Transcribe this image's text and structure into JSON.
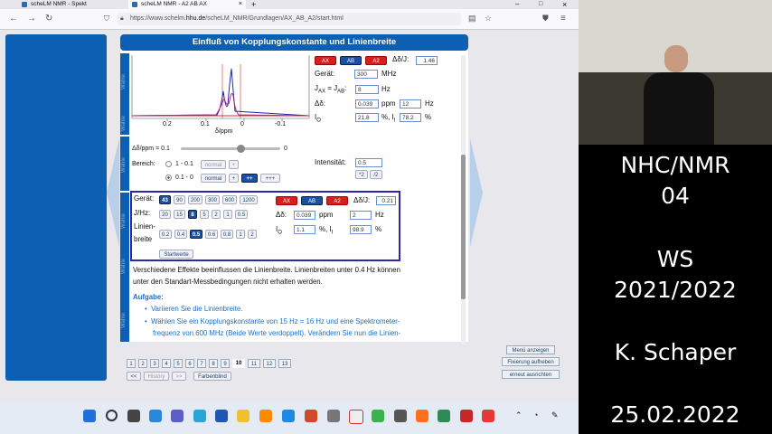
{
  "browser": {
    "tabs": [
      {
        "label": "scheLM NMR - Spekt"
      },
      {
        "label": "scheLM NMR - A2 AB AX"
      }
    ],
    "new_tab": "+",
    "url_prefix": "https://www.schelm.",
    "url_domain": "hhu.de",
    "url_path": "/scheLM_NMR/Grundlagen/AX_AB_A2/start.html"
  },
  "page": {
    "title": "Einfluß von Kopplungskonstante und Linienbreite",
    "side_label": "Wähle",
    "spectrum": {
      "ticks": [
        "0.2",
        "0.1",
        "0",
        "-0.1"
      ],
      "xlabel": "δ/ppm",
      "slider_label": "Δδ/ppm = 0.1",
      "slider_end": "0",
      "slider_value_fraction": 0.6
    },
    "bereich": {
      "label": "Bereich:",
      "opt1": "1 - 0.1",
      "opt1_btn": "normal",
      "opt1_plus": "+",
      "opt2": "0.1 - 0",
      "opt2_btn": "normal",
      "opt2_b1": "+",
      "opt2_b2": "++",
      "opt2_b3": "+++"
    },
    "top_panel": {
      "btn_ax": "AX",
      "btn_ab": "AB",
      "btn_a2": "A2",
      "ratio_label": "Δδ/J:",
      "ratio_value": "1.46",
      "geraet_label": "Gerät:",
      "geraet_value": "300",
      "geraet_unit": "MHz",
      "j_label": "J",
      "j_sub1": "AX",
      "j_eq": " = J",
      "j_sub2": "AB",
      "j_colon": ":",
      "j_value": "8",
      "j_unit": "Hz",
      "dd_label": "Δδ:",
      "dd_value": "0.039",
      "dd_unit": "ppm",
      "dd_hz_value": "12",
      "dd_hz_unit": "Hz",
      "i_label": "I",
      "i_sub": "O",
      "i_value": "21.8",
      "i_mid": "%, I",
      "i_sub2": "I",
      "i_value2": "78.2",
      "i_unit": "%",
      "intens_label": "Intensität:",
      "intens_value": "0.5",
      "intens_b1": "*2",
      "intens_b2": "/2"
    },
    "lower_panel": {
      "geraet_label": "Gerät:",
      "geraet_opts": [
        "43",
        "90",
        "200",
        "300",
        "600",
        "1200"
      ],
      "j_label": "J/Hz:",
      "j_opts": [
        "20",
        "15",
        "8",
        "5",
        "2",
        "1",
        "0.5"
      ],
      "lw_label1": "Linien-",
      "lw_label2": "breite",
      "lw_opts": [
        "0.2",
        "0.4",
        "0.5",
        "0.6",
        "0.8",
        "1",
        "2"
      ],
      "start_btn": "Startwerte",
      "btn_ax": "AX",
      "btn_ab": "AB",
      "btn_a2": "A2",
      "ratio_label": "Δδ/J:",
      "ratio_value": "0.21",
      "dd_label": "Δδ:",
      "dd_value": "0.039",
      "dd_unit": "ppm",
      "dd_hz_value": "2",
      "dd_hz_unit": "Hz",
      "i_label": "I",
      "i_sub": "O",
      "i_value": "1.1",
      "i_mid": "%, I",
      "i_sub2": "I",
      "i_value2": "98.9",
      "i_unit": "%"
    },
    "text1": "Verschiedene Effekte beeinflussen die Linienbreite. Linienbreiten unter 0.4 Hz können",
    "text2": "unter den Standart-Messbedingungen nicht erhalten werden.",
    "task_heading": "Aufgabe:",
    "bullet1": "Variieren Sie die Linienbreite.",
    "bullet2a": "Wählen Sie ein Kopplungskonstante von 15 Hz = 16 Hz und eine Spektrometer-",
    "bullet2b": "frequenz von 600 MHz (Beide Werte verdoppelt). Verändern Sie nun die Linien-",
    "pages": [
      "1",
      "2",
      "3",
      "4",
      "5",
      "6",
      "7",
      "8",
      "9",
      "10",
      "11",
      "12",
      "13"
    ],
    "current_page": "10",
    "nav_prev": "<<",
    "nav_history": "History",
    "nav_next": ">>",
    "nav_colorblind": "Farbenblind",
    "side_btns": [
      "Menü anzeigen",
      "Fixierung aufheben",
      "erneut ausrichten"
    ]
  },
  "overlay": {
    "line1": "NHC/NMR",
    "line2": "04",
    "line3": "WS",
    "line4": "2021/2022",
    "line5": "K. Schaper",
    "line6": "25.02.2022"
  },
  "colors": {
    "accent": "#0d5fb3",
    "red": "#d81e1e",
    "overlay_bg": "#000000"
  }
}
